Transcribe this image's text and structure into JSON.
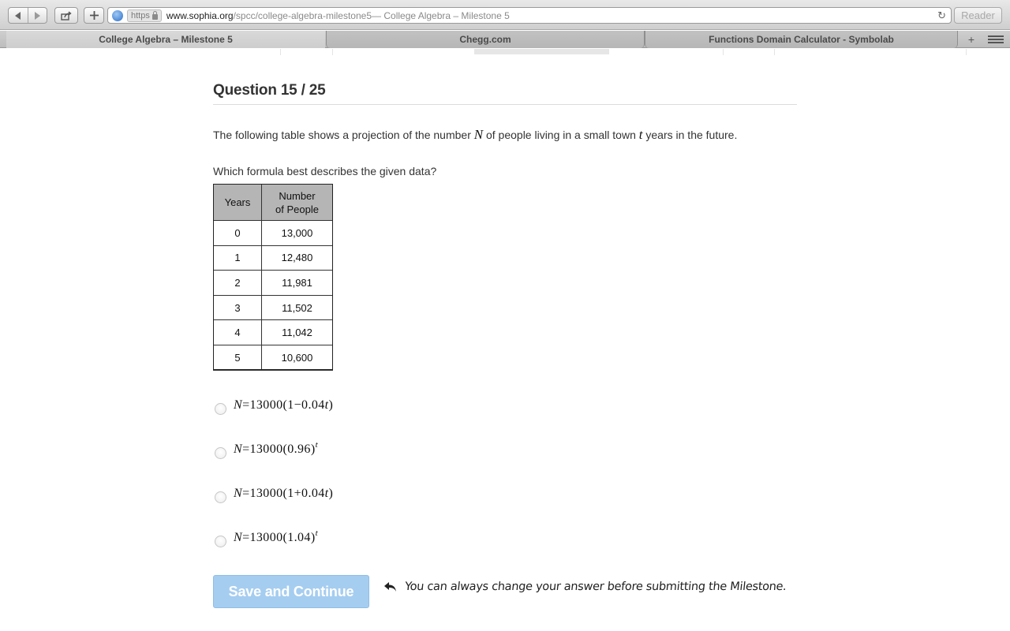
{
  "browser": {
    "url_scheme": "https",
    "url_host": "www.sophia.org",
    "url_path": "/spcc/college-algebra-milestone5",
    "window_title": " — College Algebra – Milestone 5",
    "reader_label": "Reader",
    "tabs": [
      {
        "label": "College Algebra – Milestone 5",
        "active": true
      },
      {
        "label": "Chegg.com",
        "active": false
      },
      {
        "label": "Functions Domain Calculator - Symbolab",
        "active": false
      }
    ]
  },
  "question": {
    "title": "Question 15 / 25",
    "prompt_part1": "The following table shows a projection of the number ",
    "var_n": "N",
    "prompt_part2": " of people living in a small town ",
    "var_t": "t",
    "prompt_part3": " years in the future.",
    "ask": "Which formula best describes the given data?"
  },
  "table": {
    "headers": [
      "Years",
      "Number of People"
    ],
    "header_line1": "Number",
    "header_line2": "of People",
    "rows": [
      [
        "0",
        "13,000"
      ],
      [
        "1",
        "12,480"
      ],
      [
        "2",
        "11,981"
      ],
      [
        "3",
        "11,502"
      ],
      [
        "4",
        "11,042"
      ],
      [
        "5",
        "10,600"
      ]
    ]
  },
  "choices": [
    {
      "var": "N",
      "body": "=13000(1−0.04",
      "var2": "t",
      "tail": ")",
      "sup": ""
    },
    {
      "var": "N",
      "body": "=13000(0.96)",
      "var2": "",
      "tail": "",
      "sup": "t"
    },
    {
      "var": "N",
      "body": "=13000(1+0.04",
      "var2": "t",
      "tail": ")",
      "sup": ""
    },
    {
      "var": "N",
      "body": "=13000(1.04)",
      "var2": "",
      "tail": "",
      "sup": "t"
    }
  ],
  "actions": {
    "save_label": "Save and Continue",
    "hint": "You can always change your answer before submitting the Milestone."
  },
  "colors": {
    "save_button": "#a5cdf0",
    "table_header": "#b5b5b5"
  }
}
